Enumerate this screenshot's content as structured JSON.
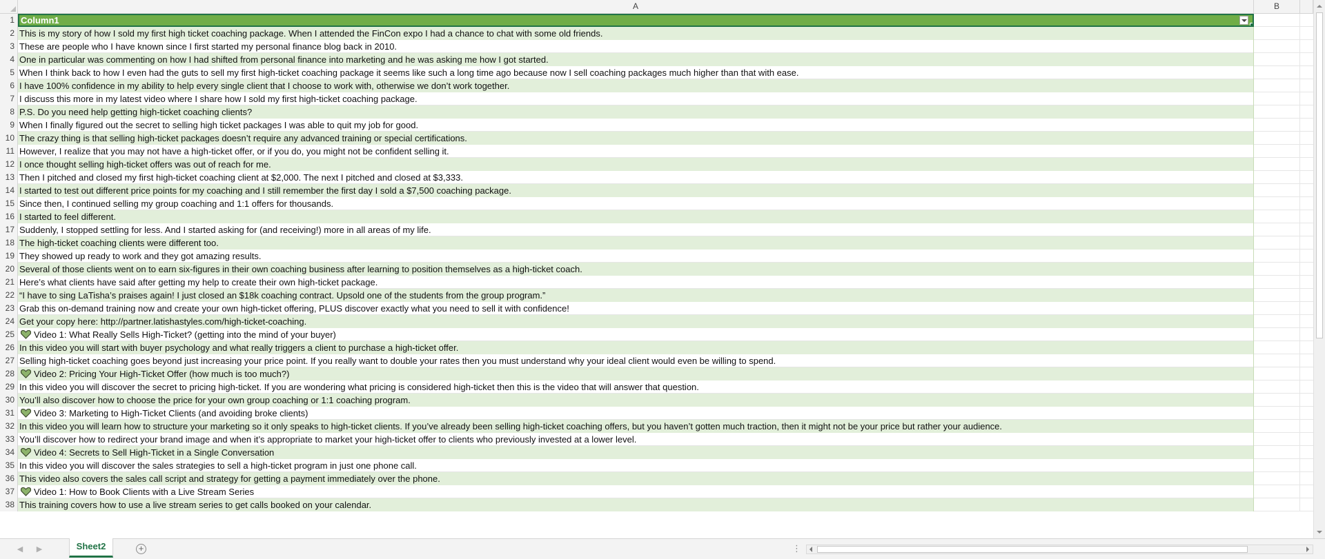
{
  "columns": {
    "a": "A",
    "b": "B"
  },
  "header_row": {
    "number": "1",
    "value": "Column1"
  },
  "rows": [
    {
      "num": "2",
      "text": "This is my story of how I sold my first high ticket coaching package. When I attended the FinCon expo I had a chance to chat with some old friends.",
      "heart": false
    },
    {
      "num": "3",
      "text": "These are people who I have known since I first started my personal finance blog back in 2010.",
      "heart": false
    },
    {
      "num": "4",
      "text": "One in particular was commenting on how I had shifted from personal finance into marketing and he was asking me how I got started.",
      "heart": false
    },
    {
      "num": "5",
      "text": "When I think back to how I even had the guts to sell my first high-ticket coaching package it seems like such a long time ago because now I sell coaching packages much higher than that with ease.",
      "heart": false
    },
    {
      "num": "6",
      "text": "I have 100% confidence in my ability to help every single client that I choose to work with, otherwise we don’t work together.",
      "heart": false
    },
    {
      "num": "7",
      "text": "I discuss this more in my latest video where I share how I sold my first high-ticket coaching package.",
      "heart": false
    },
    {
      "num": "8",
      "text": "P.S. Do you need help getting high-ticket coaching clients?",
      "heart": false
    },
    {
      "num": "9",
      "text": "When I finally figured out the secret to selling high ticket packages I was able to quit my job for good.",
      "heart": false
    },
    {
      "num": "10",
      "text": "The crazy thing is that selling high-ticket packages doesn’t require any advanced training or special certifications.",
      "heart": false
    },
    {
      "num": "11",
      "text": "However, I realize that you may not have a high-ticket offer, or if you do, you might not be confident selling it.",
      "heart": false
    },
    {
      "num": "12",
      "text": "I once thought selling high-ticket offers was out of reach for me.",
      "heart": false
    },
    {
      "num": "13",
      "text": "Then I pitched and closed my first high-ticket coaching client at $2,000. The next I pitched and closed at $3,333.",
      "heart": false
    },
    {
      "num": "14",
      "text": "I started to test out different price points for my coaching and I still remember the first day I sold a $7,500 coaching package.",
      "heart": false
    },
    {
      "num": "15",
      "text": "Since then, I continued selling my group coaching and 1:1 offers for thousands.",
      "heart": false
    },
    {
      "num": "16",
      "text": "I started to feel different.",
      "heart": false
    },
    {
      "num": "17",
      "text": "Suddenly, I stopped settling for less. And I started asking for (and receiving!) more in all areas of my life.",
      "heart": false
    },
    {
      "num": "18",
      "text": "The high-ticket coaching clients were different too.",
      "heart": false
    },
    {
      "num": "19",
      "text": "They showed up ready to work and they got amazing results.",
      "heart": false
    },
    {
      "num": "20",
      "text": "Several of those clients went on to earn six-figures in their own coaching business after learning to position themselves as a high-ticket coach.",
      "heart": false
    },
    {
      "num": "21",
      "text": "Here’s what clients have said after getting my help to create their own high-ticket package.",
      "heart": false
    },
    {
      "num": "22",
      "text": "“I have to sing LaTisha’s praises again! I just closed an $18k coaching contract. Upsold one of the students from the group program.”",
      "heart": false
    },
    {
      "num": "23",
      "text": "Grab this on-demand training now and create your own high-ticket offering, PLUS discover exactly what you need to sell it with confidence!",
      "heart": false
    },
    {
      "num": "24",
      "text": "Get your copy here: http://partner.latishastyles.com/high-ticket-coaching.",
      "heart": false
    },
    {
      "num": "25",
      "text": "Video 1: What Really Sells High-Ticket? (getting into the mind of your buyer)",
      "heart": true
    },
    {
      "num": "26",
      "text": "In this video you will start with buyer psychology and what really triggers a client to purchase a high-ticket offer.",
      "heart": false
    },
    {
      "num": "27",
      "text": "Selling high-ticket coaching goes beyond just increasing your price point. If you really want to double your rates then you must understand why your ideal client would even be willing to spend.",
      "heart": false
    },
    {
      "num": "28",
      "text": "Video 2: Pricing Your High-Ticket Offer (how much is too much?)",
      "heart": true
    },
    {
      "num": "29",
      "text": "In this video you will discover the secret to pricing high-ticket. If you are wondering what pricing is considered high-ticket then this is the video that will answer that question.",
      "heart": false
    },
    {
      "num": "30",
      "text": "You’ll also discover how to choose the price for your own group coaching or 1:1 coaching program.",
      "heart": false
    },
    {
      "num": "31",
      "text": "Video 3: Marketing to High-Ticket Clients (and avoiding broke clients)",
      "heart": true
    },
    {
      "num": "32",
      "text": "In this video you will learn how to structure your marketing so it only speaks to high-ticket clients. If you’ve already been selling high-ticket coaching offers, but you haven’t gotten much traction, then it might not be your price but rather your audience.",
      "heart": false
    },
    {
      "num": "33",
      "text": "You’ll discover how to redirect your brand image and when it’s appropriate to market your high-ticket offer to clients who previously invested at a lower level.",
      "heart": false
    },
    {
      "num": "34",
      "text": "Video 4: Secrets to Sell High-Ticket in a Single Conversation",
      "heart": true
    },
    {
      "num": "35",
      "text": "In this video you will discover the sales strategies to sell a high-ticket program in just one phone call.",
      "heart": false
    },
    {
      "num": "36",
      "text": "This video also covers the sales call script and strategy for getting a payment immediately over the phone.",
      "heart": false
    },
    {
      "num": "37",
      "text": "Video 1: How to Book Clients with a Live Stream Series",
      "heart": true
    },
    {
      "num": "38",
      "text": "This training covers how to use a live stream series to get calls booked on your calendar.",
      "heart": false
    }
  ],
  "sheet_tabs": [
    {
      "label": "Sheet2",
      "active": true
    }
  ],
  "colors": {
    "header_fill": "#70ad47",
    "band_fill": "#e2efda",
    "accent": "#217346"
  },
  "icons": {
    "row_bullet": "green-heart-icon",
    "add_sheet": "plus-circle-icon"
  }
}
